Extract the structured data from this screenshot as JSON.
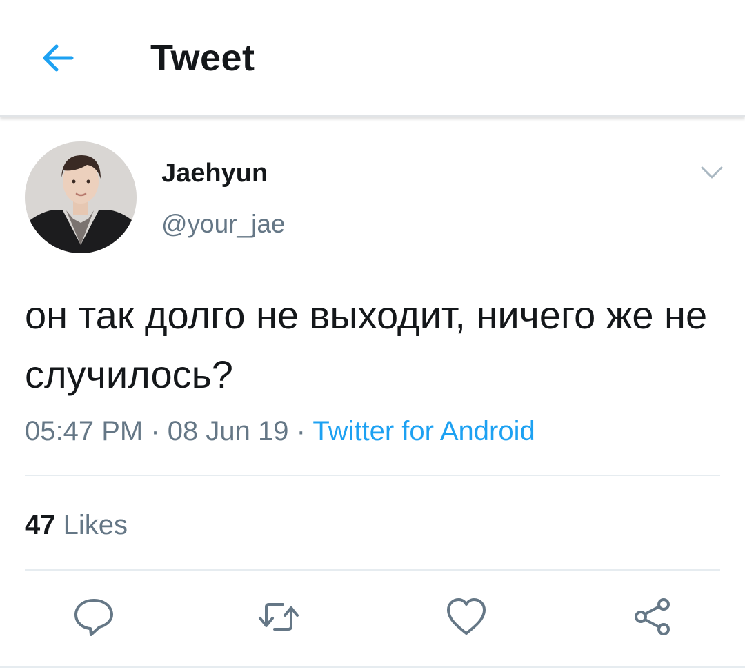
{
  "header": {
    "title": "Tweet",
    "back_icon": "arrow-left-icon"
  },
  "tweet": {
    "display_name": "Jaehyun",
    "handle": "@your_jae",
    "text": "он так долго не выходит, ничего же не случилось?",
    "time": "05:47 PM",
    "date": "08 Jun 19",
    "separator": "·",
    "source": "Twitter for Android"
  },
  "stats": {
    "likes_count": "47",
    "likes_label": "Likes"
  },
  "actions": [
    {
      "name": "reply",
      "icon": "speech-bubble-icon"
    },
    {
      "name": "retweet",
      "icon": "retweet-icon"
    },
    {
      "name": "like",
      "icon": "heart-icon"
    },
    {
      "name": "share",
      "icon": "share-icon"
    }
  ],
  "colors": {
    "accent": "#1da1f2",
    "text": "#14171a",
    "secondary": "#657786",
    "icon": "#657786"
  }
}
